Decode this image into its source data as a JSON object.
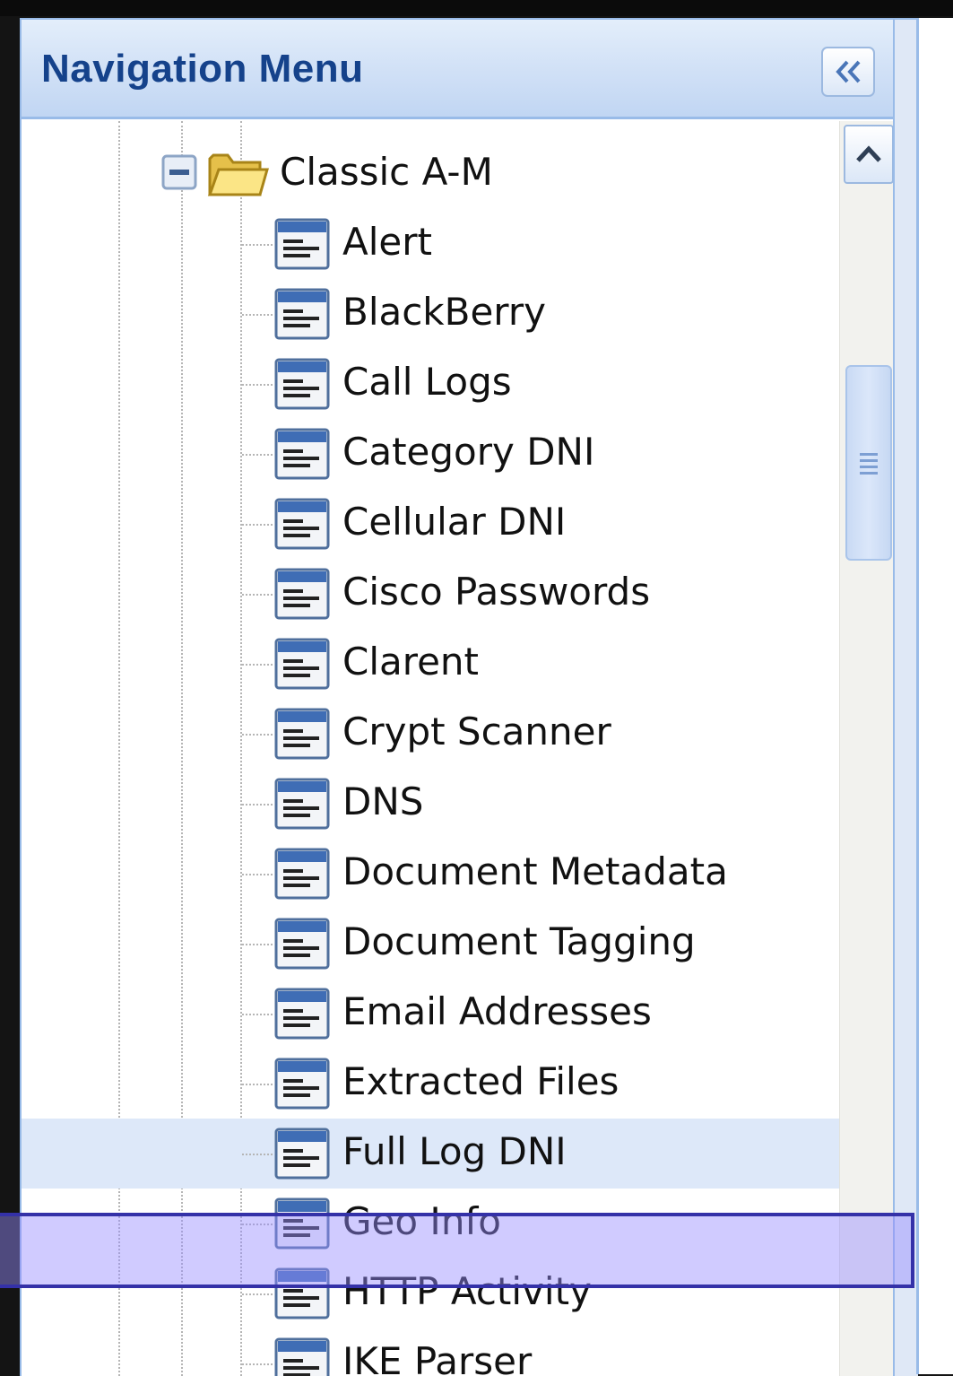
{
  "panel": {
    "title": "Navigation Menu",
    "collapse_icon": "double-chevron-left-icon"
  },
  "tree": {
    "folder": {
      "label": "Classic A-M",
      "expanded": true,
      "toggle_icon": "minus-icon",
      "icon": "folder-open-icon"
    },
    "items": [
      {
        "label": "Alert"
      },
      {
        "label": "BlackBerry"
      },
      {
        "label": "Call Logs"
      },
      {
        "label": "Category DNI"
      },
      {
        "label": "Cellular DNI"
      },
      {
        "label": "Cisco Passwords"
      },
      {
        "label": "Clarent"
      },
      {
        "label": "Crypt Scanner"
      },
      {
        "label": "DNS"
      },
      {
        "label": "Document Metadata"
      },
      {
        "label": "Document Tagging"
      },
      {
        "label": "Email Addresses"
      },
      {
        "label": "Extracted Files"
      },
      {
        "label": "Full Log DNI"
      },
      {
        "label": "Geo Info"
      },
      {
        "label": "HTTP Activity"
      },
      {
        "label": "IKE Parser"
      }
    ],
    "hovered_item": "Full Log DNI",
    "selected_item": "HTTP Activity"
  },
  "colors": {
    "header_text": "#15428b",
    "border": "#99bbe8",
    "hover_row": "#dde8f9",
    "selection_border": "#3431a8"
  }
}
